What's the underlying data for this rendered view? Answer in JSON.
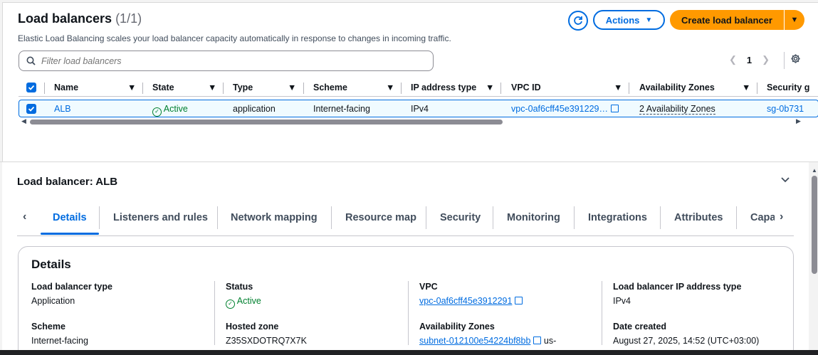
{
  "header": {
    "title": "Load balancers",
    "count": "(1/1)",
    "description": "Elastic Load Balancing scales your load balancer capacity automatically in response to changes in incoming traffic.",
    "actions_label": "Actions",
    "create_label": "Create load balancer"
  },
  "filter": {
    "placeholder": "Filter load balancers"
  },
  "pagination": {
    "page": "1"
  },
  "table": {
    "columns": [
      "Name",
      "State",
      "Type",
      "Scheme",
      "IP address type",
      "VPC ID",
      "Availability Zones",
      "Security g"
    ],
    "row": {
      "name": "ALB",
      "state": "Active",
      "type": "application",
      "scheme": "Internet-facing",
      "ip_type": "IPv4",
      "vpc_id": "vpc-0af6cff45e391229…",
      "az": "2 Availability Zones",
      "security": "sg-0b731"
    }
  },
  "details": {
    "title": "Load balancer: ALB",
    "tabs": [
      "Details",
      "Listeners and rules",
      "Network mapping",
      "Resource map",
      "Security",
      "Monitoring",
      "Integrations",
      "Attributes",
      "Capa"
    ],
    "card_title": "Details",
    "fields": {
      "lb_type_label": "Load balancer type",
      "lb_type_value": "Application",
      "status_label": "Status",
      "status_value": "Active",
      "vpc_label": "VPC",
      "vpc_value": "vpc-0af6cff45e3912291",
      "ip_type_label": "Load balancer IP address type",
      "ip_type_value": "IPv4",
      "scheme_label": "Scheme",
      "scheme_value": "Internet-facing",
      "hosted_zone_label": "Hosted zone",
      "hosted_zone_value": "Z35SXDOTRQ7X7K",
      "az_label": "Availability Zones",
      "az_value": "subnet-012100e54224bf8bb",
      "az_suffix": "us-",
      "date_label": "Date created",
      "date_value": "August 27, 2025, 14:52 (UTC+03:00)"
    }
  },
  "colors": {
    "accent": "#006ce0",
    "primary_button": "#ff9900",
    "success": "#00802f"
  }
}
